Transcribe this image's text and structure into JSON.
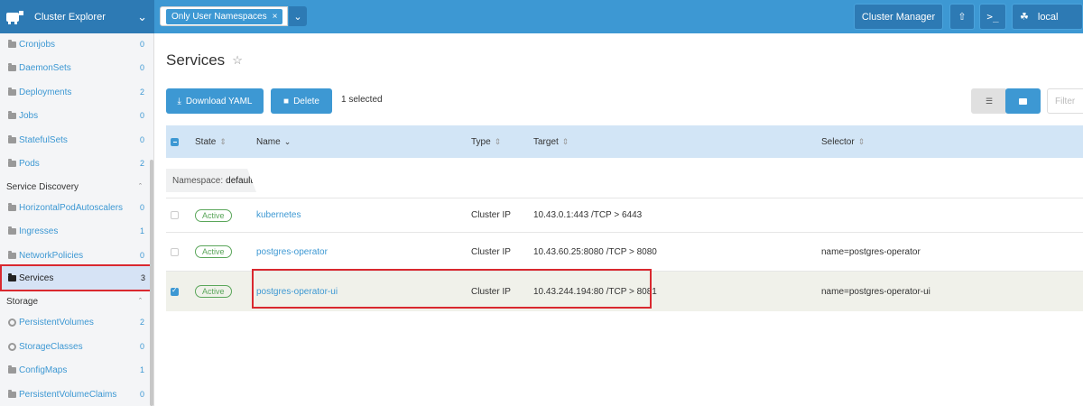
{
  "topbar": {
    "cluster_label": "Cluster Explorer",
    "namespace_filter": "Only User Namespaces",
    "namespace_remove": "×",
    "cluster_manager": "Cluster Manager",
    "cluster_name": "local"
  },
  "sidebar": {
    "items": [
      {
        "label": "Cronjobs",
        "count": "0"
      },
      {
        "label": "DaemonSets",
        "count": "0"
      },
      {
        "label": "Deployments",
        "count": "2"
      },
      {
        "label": "Jobs",
        "count": "0"
      },
      {
        "label": "StatefulSets",
        "count": "0"
      },
      {
        "label": "Pods",
        "count": "2"
      }
    ],
    "group_service_discovery": "Service Discovery",
    "service_items": [
      {
        "label": "HorizontalPodAutoscalers",
        "count": "0"
      },
      {
        "label": "Ingresses",
        "count": "1"
      },
      {
        "label": "NetworkPolicies",
        "count": "0"
      },
      {
        "label": "Services",
        "count": "3"
      }
    ],
    "group_storage": "Storage",
    "storage_items": [
      {
        "label": "PersistentVolumes",
        "count": "2"
      },
      {
        "label": "StorageClasses",
        "count": "0"
      },
      {
        "label": "ConfigMaps",
        "count": "1"
      },
      {
        "label": "PersistentVolumeClaims",
        "count": "0"
      }
    ]
  },
  "main": {
    "title": "Services",
    "download_yaml": "Download YAML",
    "delete": "Delete",
    "selected_count": "1 selected",
    "filter_placeholder": "Filter"
  },
  "table": {
    "headers": {
      "state": "State",
      "name": "Name",
      "type": "Type",
      "target": "Target",
      "selector": "Selector"
    },
    "group_prefix": "Namespace:",
    "group_value": "default",
    "rows": [
      {
        "state": "Active",
        "name": "kubernetes",
        "type": "Cluster IP",
        "target": "10.43.0.1:443  /TCP > 6443",
        "selector": "",
        "selected": false
      },
      {
        "state": "Active",
        "name": "postgres-operator",
        "type": "Cluster IP",
        "target": "10.43.60.25:8080  /TCP > 8080",
        "selector": "name=postgres-operator",
        "selected": false
      },
      {
        "state": "Active",
        "name": "postgres-operator-ui",
        "type": "Cluster IP",
        "target": "10.43.244.194:80  /TCP > 8081",
        "selector": "name=postgres-operator-ui",
        "selected": true
      }
    ]
  },
  "colors": {
    "accent": "#3d98d3",
    "highlight": "#d9282f",
    "active_green": "#5aa65a"
  }
}
